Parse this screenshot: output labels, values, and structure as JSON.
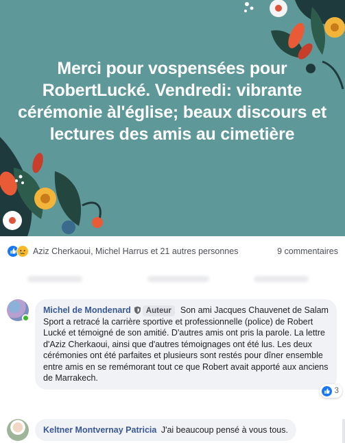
{
  "post": {
    "headline": "Merci pour vospensées pour RobertLucké. Vendredi: vibrante cérémonie àl'église; beaux discours et lectures des amis au cimetière"
  },
  "reactions": {
    "icons": [
      "like-icon",
      "sad-icon"
    ],
    "names": "Aziz Cherkaoui, Michel Harrus et 21 autres personnes",
    "comments": "9 commentaires"
  },
  "comments": [
    {
      "author": "Michel de Mondenard",
      "badge": "Auteur",
      "text": "Son ami Jacques Chauvenet de Salam Sport a retracé la carrière sportive et professionnelle (police) de Robert Lucké et témoigné de son amitié. D'autres amis ont pris la parole. La lettre d'Aziz Cherkaoui, ainsi que d'autres témoignages ont été lus. Les deux cérémonies ont été parfaites et plusieurs sont restés pour dîner ensemble entre amis en se remémorant tout ce que Robert avait apporté aux anciens de Marrakech.",
      "likes": "3"
    },
    {
      "author": "Keltner Montvernay Patricia",
      "text": "J'ai beaucoup pensé à vous tous."
    }
  ],
  "colors": {
    "background_teal": "#5f9899",
    "link_blue": "#385898",
    "like_blue": "#1877f2",
    "sad_yellow": "#f7b928"
  }
}
